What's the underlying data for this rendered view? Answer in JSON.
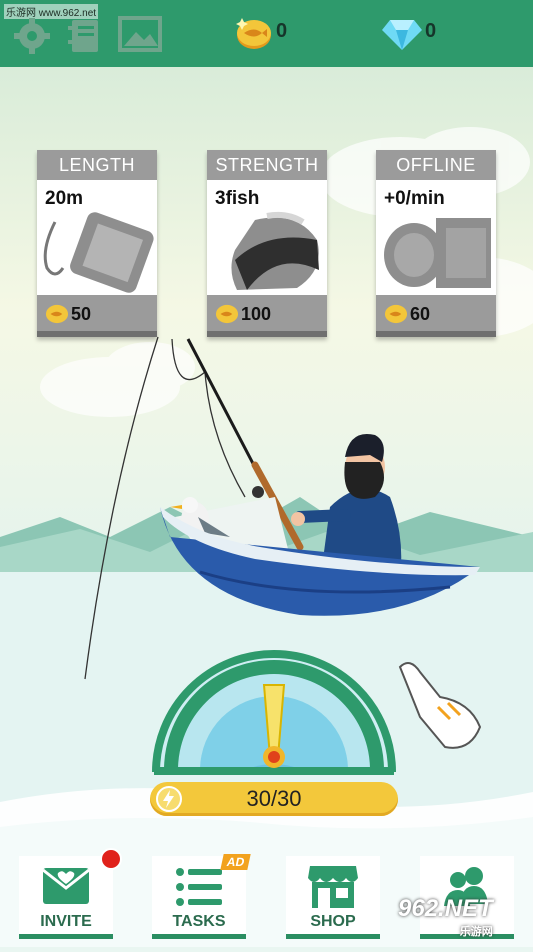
{
  "watermark": "乐游网 www.962.net",
  "topbar": {
    "icons": [
      "gear-icon",
      "book-icon",
      "gallery-icon"
    ],
    "coins": "0",
    "gems": "0",
    "colors": {
      "bar": "#2e9a6c",
      "coin": "#f1b62a",
      "gem": "#5cd0f2"
    }
  },
  "upgrades": [
    {
      "title": "LENGTH",
      "value": "20m",
      "price": "50",
      "icon": "fishing-line-spool-icon"
    },
    {
      "title": "STRENGTH",
      "value": "3fish",
      "price": "100",
      "icon": "fish-net-icon"
    },
    {
      "title": "OFFLINE",
      "value": "+0/min",
      "price": "60",
      "icon": "offline-coins-icon"
    }
  ],
  "energy": {
    "text": "30/30",
    "fraction": 1.0
  },
  "gauge": {
    "needle_level": 0.5
  },
  "nav": {
    "invite": "INVITE",
    "tasks": "TASKS",
    "tasks_badge": "AD",
    "shop": "SHOP",
    "friends_icon": "friends-icon"
  },
  "logo": {
    "text": "962.NET",
    "sub": "乐游网"
  }
}
